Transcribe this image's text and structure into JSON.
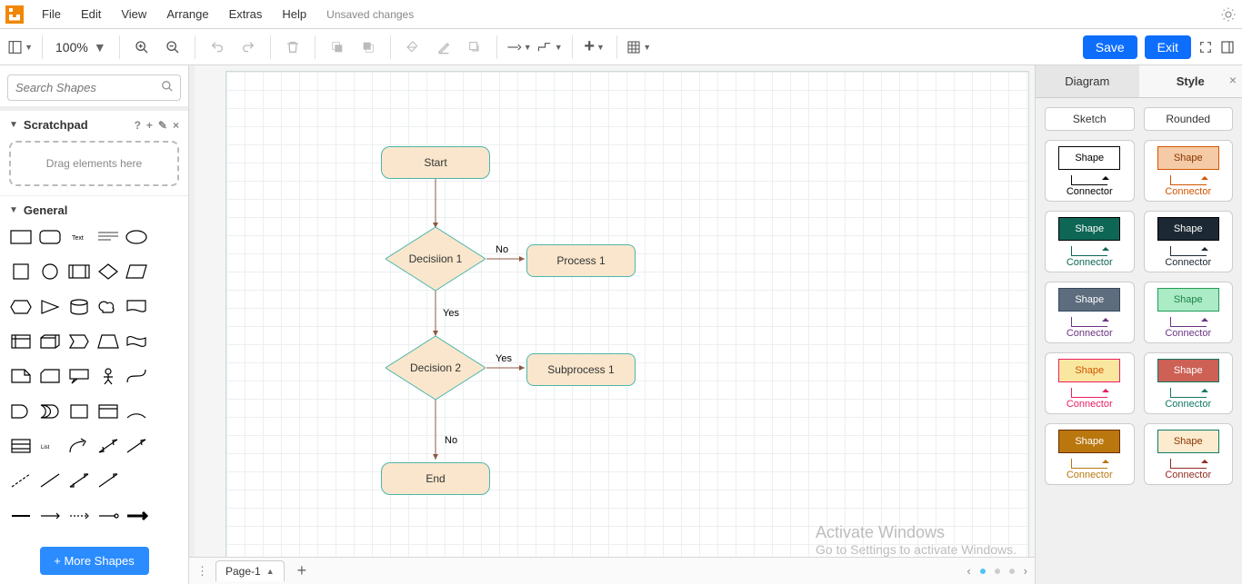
{
  "menu": {
    "file": "File",
    "edit": "Edit",
    "view": "View",
    "arrange": "Arrange",
    "extras": "Extras",
    "help": "Help",
    "unsaved": "Unsaved changes"
  },
  "toolbar": {
    "zoom": "100%",
    "save": "Save",
    "exit": "Exit"
  },
  "sidebar": {
    "search_placeholder": "Search Shapes",
    "scratchpad": {
      "title": "Scratchpad",
      "hint": "Drag elements here",
      "help": "?",
      "add": "+",
      "edit": "✎",
      "close": "×"
    },
    "general_title": "General",
    "more_shapes": "+ More Shapes"
  },
  "right": {
    "tabs": {
      "diagram": "Diagram",
      "style": "Style"
    },
    "sketch": "Sketch",
    "rounded": "Rounded",
    "card_shape": "Shape",
    "card_connector": "Connector",
    "styles": [
      {
        "bg": "#ffffff",
        "border": "#000000",
        "text": "#000000",
        "conn": "#000000"
      },
      {
        "bg": "#f5cba7",
        "border": "#d35400",
        "text": "#873600",
        "conn": "#d35400"
      },
      {
        "bg": "#0e6655",
        "border": "#000000",
        "text": "#ffffff",
        "conn": "#0e6655"
      },
      {
        "bg": "#1c2833",
        "border": "#000000",
        "text": "#ffffff",
        "conn": "#1c2833"
      },
      {
        "bg": "#5d6d7e",
        "border": "#34495e",
        "text": "#ffffff",
        "conn": "#6c3483"
      },
      {
        "bg": "#abebc6",
        "border": "#239b56",
        "text": "#1d8348",
        "conn": "#6c3483"
      },
      {
        "bg": "#f9e79f",
        "border": "#e91e63",
        "text": "#d35400",
        "conn": "#e91e63"
      },
      {
        "bg": "#cd6155",
        "border": "#117864",
        "text": "#ffffff",
        "conn": "#117864"
      },
      {
        "bg": "#b9770e",
        "border": "#6e2c00",
        "text": "#ffffff",
        "conn": "#b9770e"
      },
      {
        "bg": "#fdebd0",
        "border": "#117a65",
        "text": "#873600",
        "conn": "#922b21"
      }
    ]
  },
  "pages": {
    "page1": "Page-1"
  },
  "watermark": {
    "l1": "Activate Windows",
    "l2": "Go to Settings to activate Windows."
  },
  "diagram": {
    "nodes": {
      "start": "Start",
      "decision1": "Decisiion 1",
      "process1": "Process 1",
      "decision2": "Decision 2",
      "subprocess1": "Subprocess 1",
      "end": "End"
    },
    "labels": {
      "no": "No",
      "yes": "Yes"
    }
  }
}
